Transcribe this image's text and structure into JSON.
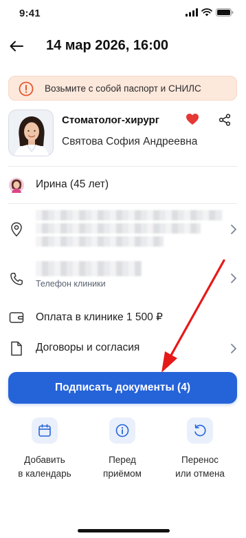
{
  "status_bar": {
    "time": "9:41"
  },
  "header": {
    "title": "14 мар 2026, 16:00"
  },
  "alert": {
    "text": "Возьмите с собой паспорт и СНИЛС"
  },
  "doctor": {
    "specialty": "Стоматолог-хирург",
    "name": "Святова София Андреевна"
  },
  "patient": {
    "name": "Ирина (45 лет)"
  },
  "phone": {
    "label": "Телефон клиники"
  },
  "payment": {
    "text": "Оплата в клинике 1 500 ₽"
  },
  "contracts": {
    "text": "Договоры и согласия"
  },
  "primary_button": {
    "label": "Подписать документы (4)"
  },
  "actions": [
    {
      "label": "Добавить\nв календарь",
      "icon": "calendar-icon"
    },
    {
      "label": "Перед\nприёмом",
      "icon": "info-icon"
    },
    {
      "label": "Перенос\nили отмена",
      "icon": "undo-icon"
    }
  ],
  "colors": {
    "accent": "#2563d9",
    "alert_bg": "#fde8dc",
    "alert_icon": "#e2572b",
    "heart": "#e53935",
    "annotation_arrow": "#e61919"
  }
}
